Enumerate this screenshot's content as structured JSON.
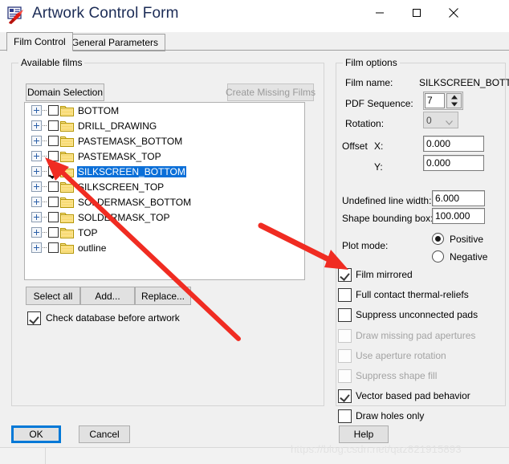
{
  "window": {
    "title": "Artwork Control Form",
    "icon": "artwork-form-icon",
    "minimize_label": "minimize-icon",
    "maximize_label": "maximize-icon",
    "close_label": "close-icon"
  },
  "tabs": [
    {
      "label": "Film Control",
      "active": true
    },
    {
      "label": "General Parameters",
      "active": false
    }
  ],
  "available_films": {
    "group_title": "Available films",
    "domain_button": "Domain Selection",
    "create_missing_button": "Create Missing Films",
    "create_missing_enabled": false,
    "tree": [
      {
        "label": "BOTTOM",
        "checked": false,
        "selected": false,
        "expandable": true
      },
      {
        "label": "DRILL_DRAWING",
        "checked": false,
        "selected": false,
        "expandable": true
      },
      {
        "label": "PASTEMASK_BOTTOM",
        "checked": false,
        "selected": false,
        "expandable": true
      },
      {
        "label": "PASTEMASK_TOP",
        "checked": false,
        "selected": false,
        "expandable": true
      },
      {
        "label": "SILKSCREEN_BOTTOM",
        "checked": true,
        "selected": true,
        "expandable": true
      },
      {
        "label": "SILKSCREEN_TOP",
        "checked": false,
        "selected": false,
        "expandable": true
      },
      {
        "label": "SOLDERMASK_BOTTOM",
        "checked": false,
        "selected": false,
        "expandable": true
      },
      {
        "label": "SOLDERMASK_TOP",
        "checked": false,
        "selected": false,
        "expandable": true
      },
      {
        "label": "TOP",
        "checked": false,
        "selected": false,
        "expandable": true
      },
      {
        "label": "outline",
        "checked": false,
        "selected": false,
        "expandable": true
      }
    ],
    "select_all_button": "Select all",
    "add_button": "Add...",
    "replace_button": "Replace...",
    "check_database": {
      "label": "Check database before artwork",
      "checked": true
    }
  },
  "film_options": {
    "group_title": "Film options",
    "film_name_label": "Film name:",
    "film_name_value": "SILKSCREEN_BOTTOM",
    "pdf_sequence_label": "PDF Sequence:",
    "pdf_sequence_value": "7",
    "rotation_label": "Rotation:",
    "rotation_value": "0",
    "rotation_enabled": false,
    "offset_label": "Offset",
    "offset_x_label": "X:",
    "offset_x_value": "0.000",
    "offset_y_label": "Y:",
    "offset_y_value": "0.000",
    "undefined_line_width_label": "Undefined line width:",
    "undefined_line_width_value": "6.000",
    "shape_bounding_box_label": "Shape bounding box:",
    "shape_bounding_box_value": "100.000",
    "plot_mode_label": "Plot mode:",
    "plot_mode_options": [
      {
        "label": "Positive",
        "selected": true
      },
      {
        "label": "Negative",
        "selected": false
      }
    ],
    "checkboxes": [
      {
        "label": "Film mirrored",
        "checked": true,
        "enabled": true
      },
      {
        "label": "Full contact thermal-reliefs",
        "checked": false,
        "enabled": true
      },
      {
        "label": "Suppress unconnected pads",
        "checked": false,
        "enabled": true
      },
      {
        "label": "Draw missing pad apertures",
        "checked": false,
        "enabled": false
      },
      {
        "label": "Use aperture rotation",
        "checked": false,
        "enabled": false
      },
      {
        "label": "Suppress shape fill",
        "checked": false,
        "enabled": false
      },
      {
        "label": "Vector based pad behavior",
        "checked": true,
        "enabled": true
      },
      {
        "label": "Draw holes only",
        "checked": false,
        "enabled": true
      }
    ]
  },
  "dialog_buttons": {
    "ok": "OK",
    "cancel": "Cancel",
    "help": "Help"
  },
  "annotations": {
    "arrow_color": "#f02c22",
    "arrow_to_checkbox": "red-arrow-to-silkscreen-checkbox",
    "arrow_to_film_mirrored": "red-arrow-to-film-mirrored"
  },
  "watermark": "https://blog.csdn.net/qaz821915893",
  "colors": {
    "selection_blue": "#0b6fd8",
    "title_text": "#1c2c56",
    "dialog_bg": "#f0f0f0",
    "focus_blue": "#0078d7"
  }
}
